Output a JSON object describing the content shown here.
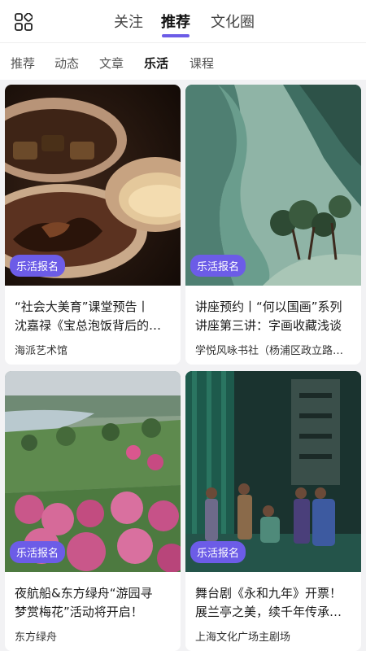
{
  "header": {
    "tabs": [
      {
        "label": "关注",
        "active": false
      },
      {
        "label": "推荐",
        "active": true
      },
      {
        "label": "文化圈",
        "active": false
      }
    ],
    "accent_color": "#6c5ce7"
  },
  "subnav": {
    "items": [
      {
        "label": "推荐",
        "active": false
      },
      {
        "label": "动态",
        "active": false
      },
      {
        "label": "文章",
        "active": false
      },
      {
        "label": "乐活",
        "active": true
      },
      {
        "label": "课程",
        "active": false
      }
    ]
  },
  "cards": [
    {
      "badge": "乐活报名",
      "title_line1": "“社会大美育”课堂预告丨",
      "title_line2": "沈嘉禄《宝总泡饭背后的…",
      "author": "海派艺术馆"
    },
    {
      "badge": "乐活报名",
      "title_line1": "讲座预约丨“何以国画”系列",
      "title_line2": "讲座第三讲：字画收藏浅谈",
      "author": "学悦风咏书社（杨浦区政立路…"
    },
    {
      "badge": "乐活报名",
      "title_line1": "夜航船&东方绿舟“游园寻",
      "title_line2": "梦赏梅花”活动将开启！",
      "author": "东方绿舟"
    },
    {
      "badge": "乐活报名",
      "title_line1": "舞台剧《永和九年》开票！",
      "title_line2": "展兰亭之美，续千年传承…",
      "author": "上海文化广场主剧场"
    }
  ]
}
